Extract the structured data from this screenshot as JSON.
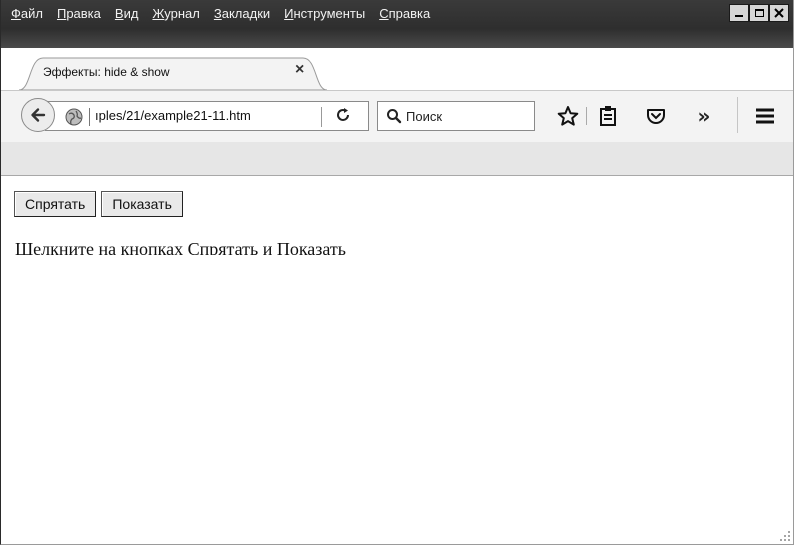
{
  "menu": {
    "items": [
      {
        "underline": "Ф",
        "rest": "айл"
      },
      {
        "underline": "П",
        "rest": "равка"
      },
      {
        "underline": "В",
        "rest": "ид"
      },
      {
        "underline": "Ж",
        "rest": "урнал"
      },
      {
        "underline": "З",
        "rest": "акладки"
      },
      {
        "underline": "И",
        "rest": "нструменты"
      },
      {
        "underline": "С",
        "rest": "правка"
      }
    ]
  },
  "tab": {
    "title": "Эффекты: hide & show",
    "close_glyph": "×",
    "newtab_glyph": "+"
  },
  "toolbar": {
    "url": "ıples/21/example21-11.htm",
    "search_placeholder": "Поиск",
    "overflow_glyph": "»"
  },
  "page": {
    "hide_button": "Спрятать",
    "show_button": "Показать",
    "paragraph": "Щелкните на кнопках Спрятать и Показать"
  }
}
